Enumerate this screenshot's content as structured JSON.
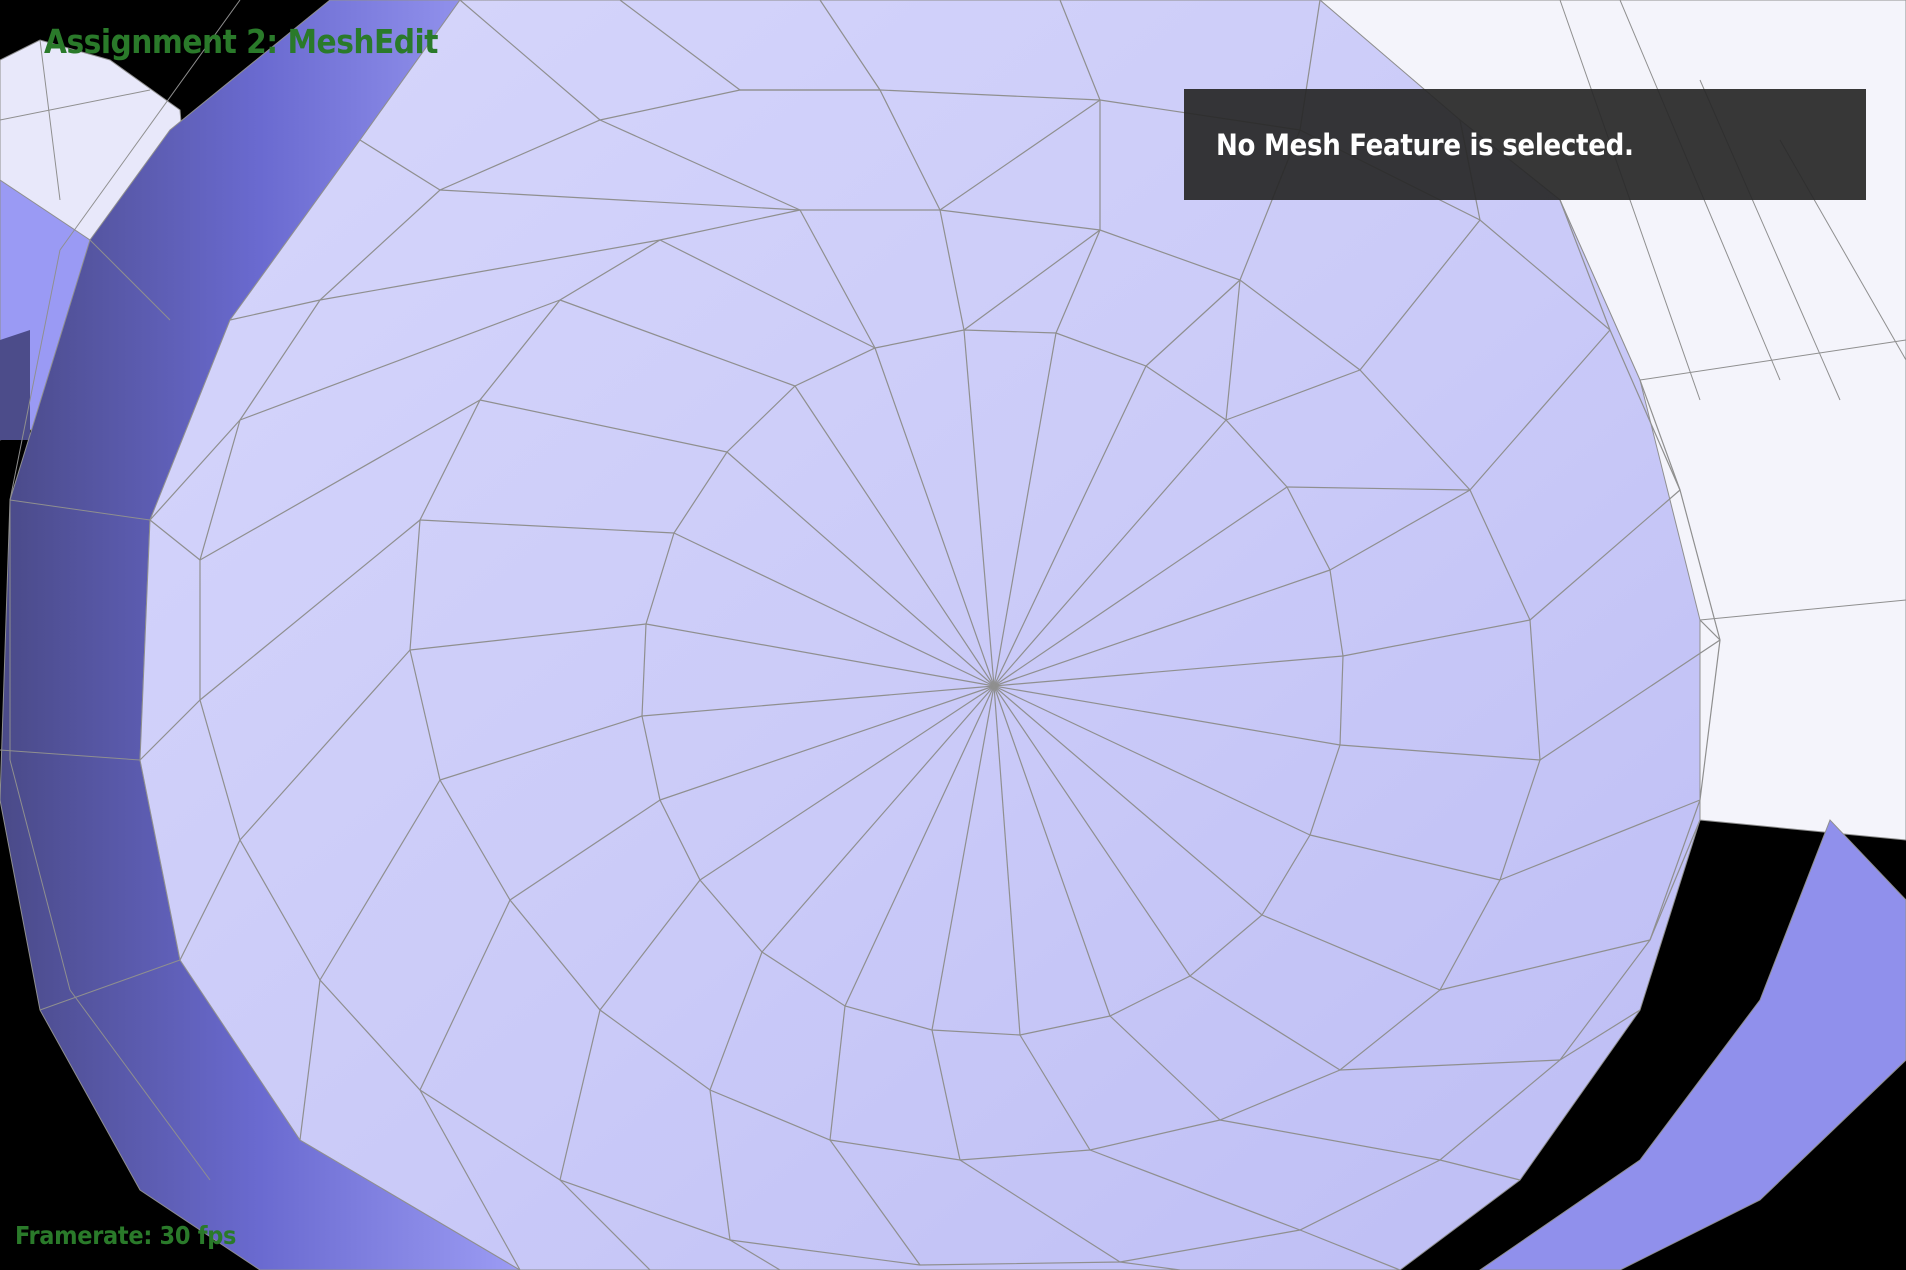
{
  "app": {
    "title": "Assignment 2: MeshEdit"
  },
  "status": {
    "message": "No Mesh Feature is selected."
  },
  "footer": {
    "framerate_label": "Framerate: 30 fps"
  },
  "colors": {
    "background": "#000000",
    "title_text": "#2a7a2a",
    "panel_background": "#282828",
    "panel_text": "#ffffff",
    "mesh_face": "#c8c8f8",
    "mesh_face_highlight": "#f2f2fb",
    "mesh_side": "#8c8cf0",
    "mesh_shadow": "#4a4a88",
    "mesh_edge": "#8f8f8f"
  },
  "viewport": {
    "content": "triangle-mesh"
  }
}
